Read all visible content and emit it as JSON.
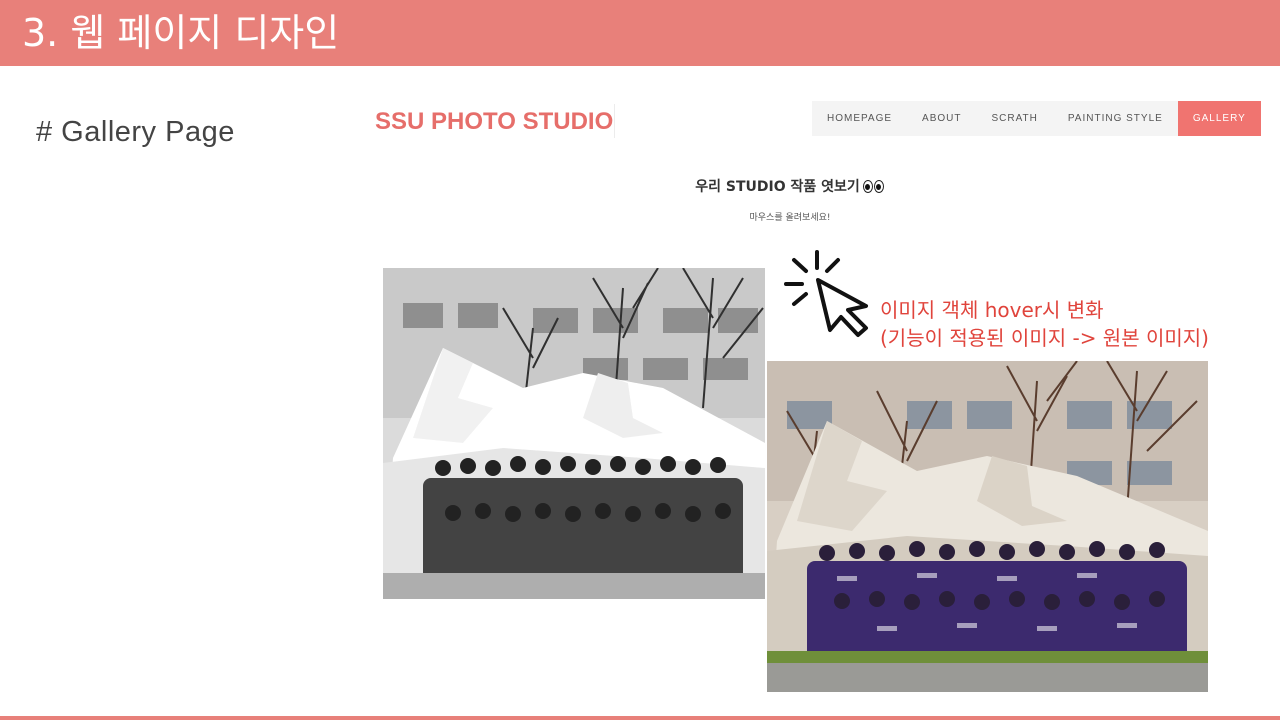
{
  "slide": {
    "title": "3. 웹 페이지 디자인",
    "section_label": "# Gallery Page",
    "accent_color": "#e8807a"
  },
  "site": {
    "brand": "SSU PHOTO STUDIO",
    "nav": [
      {
        "label": "HOMEPAGE",
        "active": false
      },
      {
        "label": "ABOUT",
        "active": false
      },
      {
        "label": "SCRATH",
        "active": false
      },
      {
        "label": "PAINTING STYLE",
        "active": false
      },
      {
        "label": "GALLERY",
        "active": true
      }
    ],
    "gallery_heading": "우리 STUDIO 작품 엿보기",
    "gallery_heading_icon": "eyes-icon",
    "gallery_sub": "마우스를 올려보세요!"
  },
  "images": {
    "gray_name": "grayscale-filtered-photo",
    "color_name": "original-color-photo"
  },
  "annotation": {
    "line1": "이미지 객체 hover시 변화",
    "line2": "(기능이 적용된 이미지 -> 원본 이미지)",
    "color": "#e0443c",
    "icon": "cursor-click-icon"
  }
}
